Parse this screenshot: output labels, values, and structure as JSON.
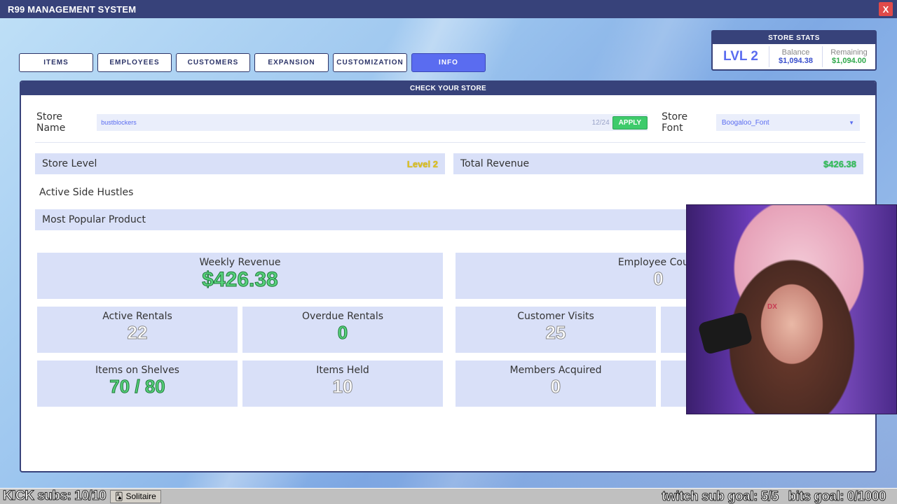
{
  "window": {
    "title": "R99 MANAGEMENT SYSTEM",
    "close": "X"
  },
  "tabs": [
    {
      "label": "ITEMS"
    },
    {
      "label": "EMPLOYEES"
    },
    {
      "label": "CUSTOMERS"
    },
    {
      "label": "EXPANSION"
    },
    {
      "label": "CUSTOMIZATION"
    },
    {
      "label": "INFO",
      "active": true
    }
  ],
  "store_stats": {
    "header": "STORE STATS",
    "level": "LVL 2",
    "balance_label": "Balance",
    "balance_value": "$1,094.38",
    "remaining_label": "Remaining",
    "remaining_value": "$1,094.00"
  },
  "panel": {
    "header": "CHECK YOUR STORE",
    "store_name_label": "Store Name",
    "store_name_value": "bustblockers",
    "store_name_counter": "12/24",
    "apply_label": "APPLY",
    "store_font_label": "Store Font",
    "store_font_value": "Boogaloo_Font",
    "store_level_label": "Store Level",
    "store_level_value": "Level 2",
    "total_revenue_label": "Total Revenue",
    "total_revenue_value": "$426.38",
    "side_hustles_label": "Active Side Hustles",
    "popular_product_label": "Most Popular Product"
  },
  "cards": {
    "weekly_revenue": {
      "label": "Weekly Revenue",
      "value": "$426.38"
    },
    "employee_count": {
      "label": "Employee Count",
      "value": "0"
    },
    "active_rentals": {
      "label": "Active Rentals",
      "value": "22"
    },
    "overdue_rentals": {
      "label": "Overdue Rentals",
      "value": "0"
    },
    "customer_visits": {
      "label": "Customer Visits",
      "value": "25"
    },
    "items_on_shelves": {
      "label": "Items on Shelves",
      "value": "70 / 80"
    },
    "items_held": {
      "label": "Items Held",
      "value": "10"
    },
    "members_acquired": {
      "label": "Members Acquired",
      "value": "0"
    }
  },
  "webcam": {
    "chair_text": "DX"
  },
  "overlay": {
    "kick": "KICK subs: 10/10",
    "taskbar_item": "Solitaire",
    "twitch_goal": "twitch sub goal: 5/5",
    "bits_goal": "bits goal: 0/1000"
  },
  "colors": {
    "accent": "#5a6cf0",
    "header": "#37427a",
    "green": "#36c25e",
    "yellow": "#e0c21a"
  }
}
